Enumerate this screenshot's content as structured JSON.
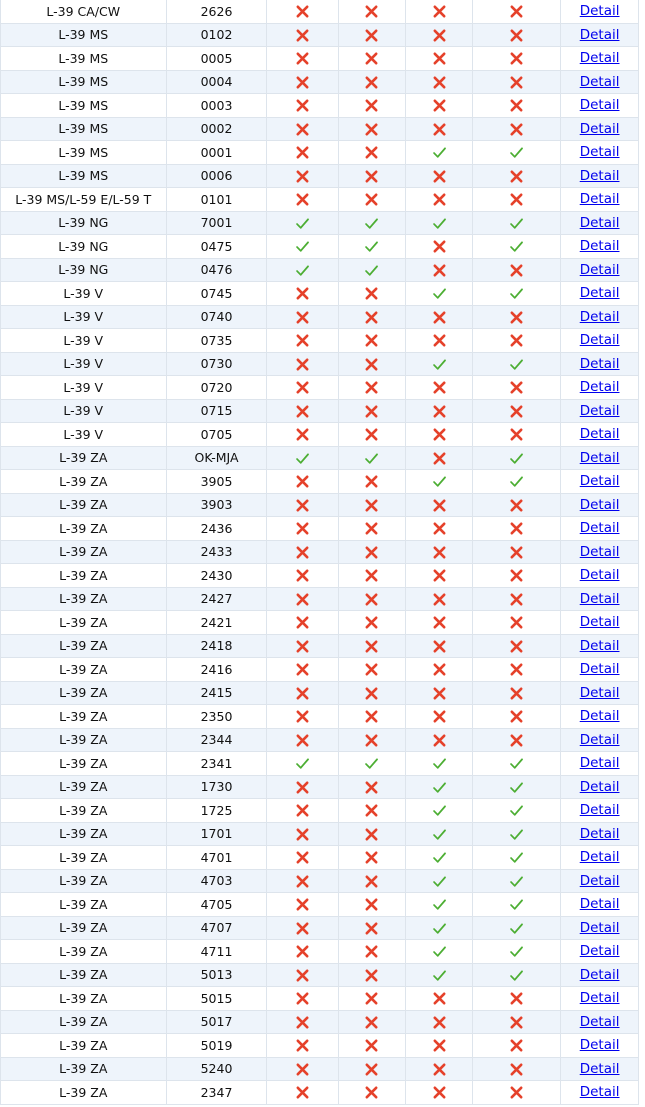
{
  "table": {
    "detail_label": "Detail",
    "colors": {
      "yes": "#4cae33",
      "no": "#e5412a",
      "link": "#0000ee",
      "row_alt": "#eef4fb"
    },
    "icons": {
      "yes": "check-icon",
      "no": "cross-icon"
    },
    "rows": [
      {
        "model": "L-39 CA/CW",
        "serial": "2626",
        "flags": [
          0,
          0,
          0,
          0
        ]
      },
      {
        "model": "L-39 MS",
        "serial": "0102",
        "flags": [
          0,
          0,
          0,
          0
        ]
      },
      {
        "model": "L-39 MS",
        "serial": "0005",
        "flags": [
          0,
          0,
          0,
          0
        ]
      },
      {
        "model": "L-39 MS",
        "serial": "0004",
        "flags": [
          0,
          0,
          0,
          0
        ]
      },
      {
        "model": "L-39 MS",
        "serial": "0003",
        "flags": [
          0,
          0,
          0,
          0
        ]
      },
      {
        "model": "L-39 MS",
        "serial": "0002",
        "flags": [
          0,
          0,
          0,
          0
        ]
      },
      {
        "model": "L-39 MS",
        "serial": "0001",
        "flags": [
          0,
          0,
          1,
          1
        ]
      },
      {
        "model": "L-39 MS",
        "serial": "0006",
        "flags": [
          0,
          0,
          0,
          0
        ]
      },
      {
        "model": "L-39 MS/L-59 E/L-59 T",
        "serial": "0101",
        "flags": [
          0,
          0,
          0,
          0
        ]
      },
      {
        "model": "L-39 NG",
        "serial": "7001",
        "flags": [
          1,
          1,
          1,
          1
        ]
      },
      {
        "model": "L-39 NG",
        "serial": "0475",
        "flags": [
          1,
          1,
          0,
          1
        ]
      },
      {
        "model": "L-39 NG",
        "serial": "0476",
        "flags": [
          1,
          1,
          0,
          0
        ]
      },
      {
        "model": "L-39 V",
        "serial": "0745",
        "flags": [
          0,
          0,
          1,
          1
        ]
      },
      {
        "model": "L-39 V",
        "serial": "0740",
        "flags": [
          0,
          0,
          0,
          0
        ]
      },
      {
        "model": "L-39 V",
        "serial": "0735",
        "flags": [
          0,
          0,
          0,
          0
        ]
      },
      {
        "model": "L-39 V",
        "serial": "0730",
        "flags": [
          0,
          0,
          1,
          1
        ]
      },
      {
        "model": "L-39 V",
        "serial": "0720",
        "flags": [
          0,
          0,
          0,
          0
        ]
      },
      {
        "model": "L-39 V",
        "serial": "0715",
        "flags": [
          0,
          0,
          0,
          0
        ]
      },
      {
        "model": "L-39 V",
        "serial": "0705",
        "flags": [
          0,
          0,
          0,
          0
        ]
      },
      {
        "model": "L-39 ZA",
        "serial": "OK-MJA",
        "flags": [
          1,
          1,
          0,
          1
        ]
      },
      {
        "model": "L-39 ZA",
        "serial": "3905",
        "flags": [
          0,
          0,
          1,
          1
        ]
      },
      {
        "model": "L-39 ZA",
        "serial": "3903",
        "flags": [
          0,
          0,
          0,
          0
        ]
      },
      {
        "model": "L-39 ZA",
        "serial": "2436",
        "flags": [
          0,
          0,
          0,
          0
        ]
      },
      {
        "model": "L-39 ZA",
        "serial": "2433",
        "flags": [
          0,
          0,
          0,
          0
        ]
      },
      {
        "model": "L-39 ZA",
        "serial": "2430",
        "flags": [
          0,
          0,
          0,
          0
        ]
      },
      {
        "model": "L-39 ZA",
        "serial": "2427",
        "flags": [
          0,
          0,
          0,
          0
        ]
      },
      {
        "model": "L-39 ZA",
        "serial": "2421",
        "flags": [
          0,
          0,
          0,
          0
        ]
      },
      {
        "model": "L-39 ZA",
        "serial": "2418",
        "flags": [
          0,
          0,
          0,
          0
        ]
      },
      {
        "model": "L-39 ZA",
        "serial": "2416",
        "flags": [
          0,
          0,
          0,
          0
        ]
      },
      {
        "model": "L-39 ZA",
        "serial": "2415",
        "flags": [
          0,
          0,
          0,
          0
        ]
      },
      {
        "model": "L-39 ZA",
        "serial": "2350",
        "flags": [
          0,
          0,
          0,
          0
        ]
      },
      {
        "model": "L-39 ZA",
        "serial": "2344",
        "flags": [
          0,
          0,
          0,
          0
        ]
      },
      {
        "model": "L-39 ZA",
        "serial": "2341",
        "flags": [
          1,
          1,
          1,
          1
        ]
      },
      {
        "model": "L-39 ZA",
        "serial": "1730",
        "flags": [
          0,
          0,
          1,
          1
        ]
      },
      {
        "model": "L-39 ZA",
        "serial": "1725",
        "flags": [
          0,
          0,
          1,
          1
        ]
      },
      {
        "model": "L-39 ZA",
        "serial": "1701",
        "flags": [
          0,
          0,
          1,
          1
        ]
      },
      {
        "model": "L-39 ZA",
        "serial": "4701",
        "flags": [
          0,
          0,
          1,
          1
        ]
      },
      {
        "model": "L-39 ZA",
        "serial": "4703",
        "flags": [
          0,
          0,
          1,
          1
        ]
      },
      {
        "model": "L-39 ZA",
        "serial": "4705",
        "flags": [
          0,
          0,
          1,
          1
        ]
      },
      {
        "model": "L-39 ZA",
        "serial": "4707",
        "flags": [
          0,
          0,
          1,
          1
        ]
      },
      {
        "model": "L-39 ZA",
        "serial": "4711",
        "flags": [
          0,
          0,
          1,
          1
        ]
      },
      {
        "model": "L-39 ZA",
        "serial": "5013",
        "flags": [
          0,
          0,
          1,
          1
        ]
      },
      {
        "model": "L-39 ZA",
        "serial": "5015",
        "flags": [
          0,
          0,
          0,
          0
        ]
      },
      {
        "model": "L-39 ZA",
        "serial": "5017",
        "flags": [
          0,
          0,
          0,
          0
        ]
      },
      {
        "model": "L-39 ZA",
        "serial": "5019",
        "flags": [
          0,
          0,
          0,
          0
        ]
      },
      {
        "model": "L-39 ZA",
        "serial": "5240",
        "flags": [
          0,
          0,
          0,
          0
        ]
      },
      {
        "model": "L-39 ZA",
        "serial": "2347",
        "flags": [
          0,
          0,
          0,
          0
        ]
      }
    ]
  }
}
